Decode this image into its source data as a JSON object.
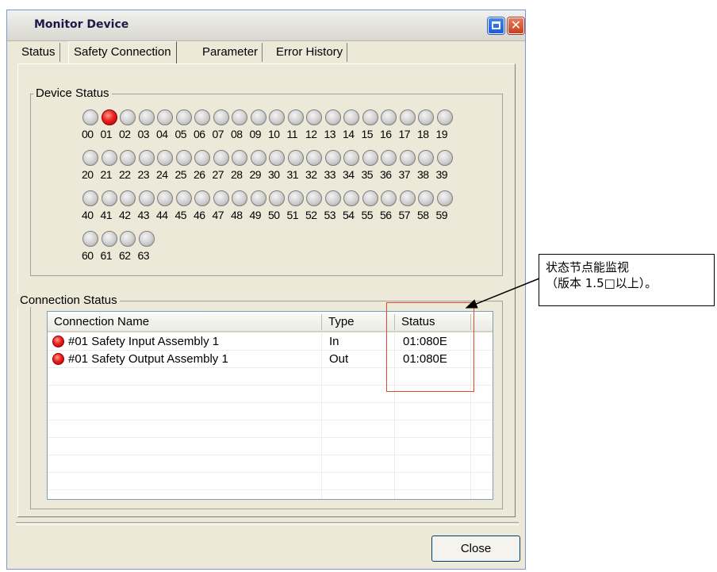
{
  "window": {
    "title": "Monitor Device"
  },
  "tabs": [
    {
      "label": "Status"
    },
    {
      "label": "Safety Connection"
    },
    {
      "label": "Parameter"
    },
    {
      "label": "Error History"
    }
  ],
  "device_status": {
    "label": "Device Status",
    "active_node": "01",
    "active_color": "#e81c1c",
    "rows": [
      [
        "00",
        "01",
        "02",
        "03",
        "04",
        "05",
        "06",
        "07",
        "08",
        "09",
        "10",
        "11",
        "12",
        "13",
        "14",
        "15",
        "16",
        "17",
        "18",
        "19"
      ],
      [
        "20",
        "21",
        "22",
        "23",
        "24",
        "25",
        "26",
        "27",
        "28",
        "29",
        "30",
        "31",
        "32",
        "33",
        "34",
        "35",
        "36",
        "37",
        "38",
        "39"
      ],
      [
        "40",
        "41",
        "42",
        "43",
        "44",
        "45",
        "46",
        "47",
        "48",
        "49",
        "50",
        "51",
        "52",
        "53",
        "54",
        "55",
        "56",
        "57",
        "58",
        "59"
      ],
      [
        "60",
        "61",
        "62",
        "63"
      ]
    ]
  },
  "connection_status": {
    "label": "Connection Status",
    "columns": [
      "Connection Name",
      "Type",
      "Status"
    ],
    "rows": [
      {
        "name": "#01 Safety Input Assembly 1",
        "type": "In",
        "status": "01:080E"
      },
      {
        "name": "#01 Safety Output Assembly 1",
        "type": "Out",
        "status": "01:080E"
      }
    ]
  },
  "footer": {
    "close_label": "Close"
  },
  "annotation": {
    "line1": "状态节点能监视",
    "line2": "（版本 1.5□以上）。",
    "highlight_color": "#e04a2a"
  }
}
